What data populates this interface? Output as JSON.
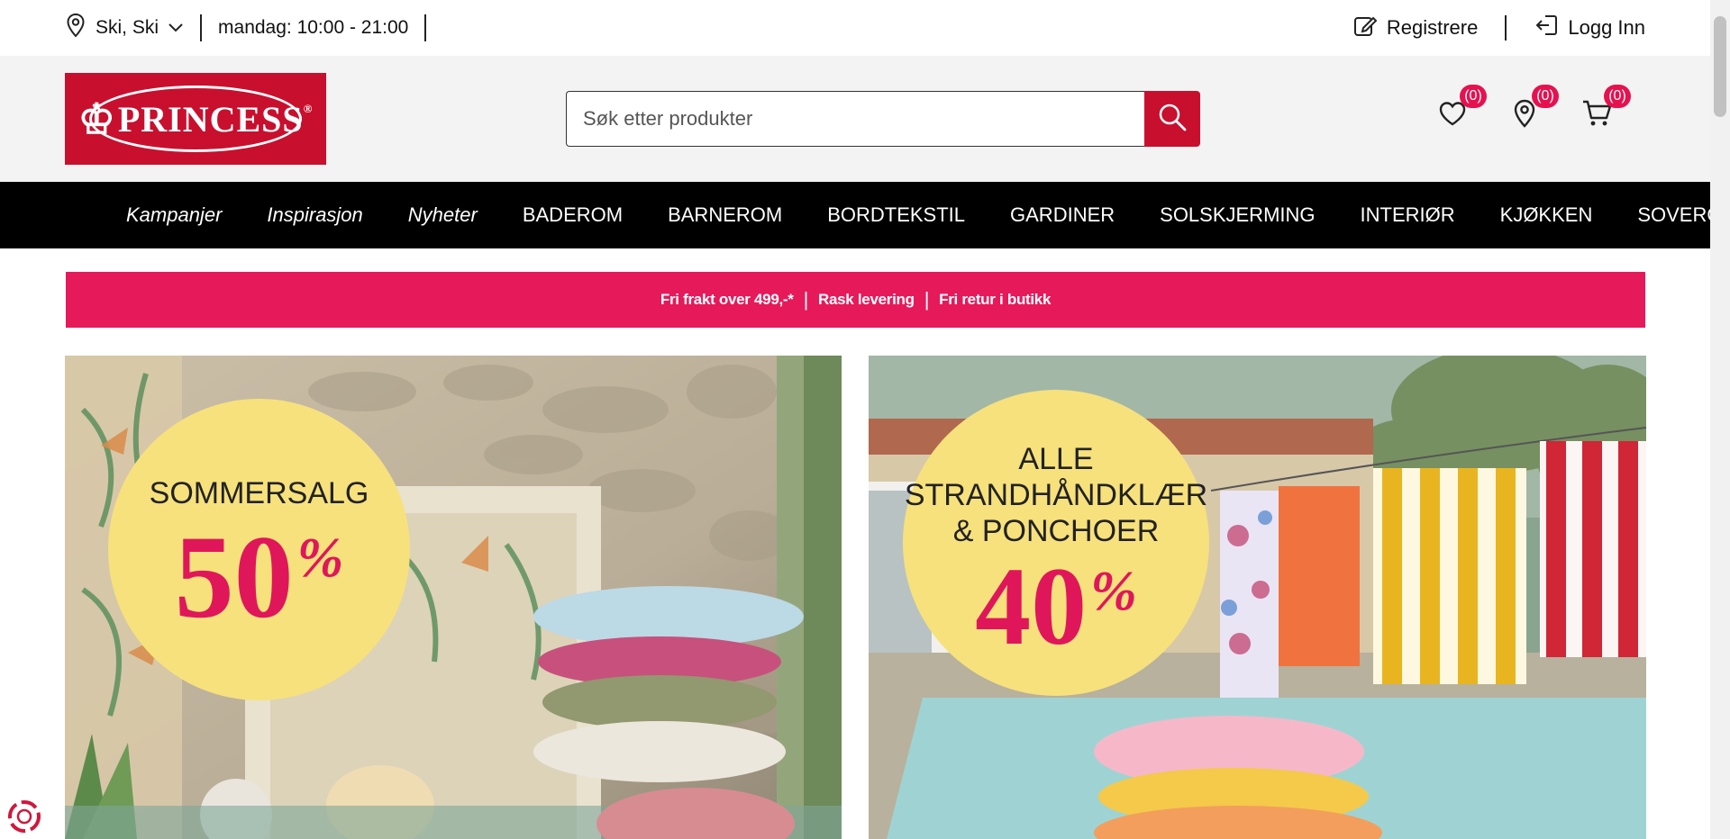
{
  "topbar": {
    "location": "Ski, Ski",
    "hours": "mandag: 10:00 - 21:00",
    "register": "Registrere",
    "login": "Logg Inn"
  },
  "header": {
    "logo_text": "PRINCESS",
    "search_placeholder": "Søk etter produkter",
    "wishlist_count": "(0)",
    "stores_count": "(0)",
    "cart_count": "(0)"
  },
  "nav": {
    "items": [
      {
        "label": "Kampanjer",
        "italic": true
      },
      {
        "label": "Inspirasjon",
        "italic": true
      },
      {
        "label": "Nyheter",
        "italic": true
      },
      {
        "label": "BADEROM"
      },
      {
        "label": "BARNEROM"
      },
      {
        "label": "BORDTEKSTIL"
      },
      {
        "label": "GARDINER"
      },
      {
        "label": "SOLSKJERMING"
      },
      {
        "label": "INTERIØR"
      },
      {
        "label": "KJØKKEN"
      },
      {
        "label": "SOVEROM"
      }
    ]
  },
  "promo": {
    "parts": [
      "Fri frakt over 499,-*",
      "Rask levering",
      "Fri retur i butikk"
    ]
  },
  "banners": {
    "left": {
      "title": "SOMMERSALG",
      "percent": "50",
      "percent_sign": "%"
    },
    "right": {
      "title_line1": "ALLE",
      "title_line2": "STRANDHÅNDKLÆR",
      "title_line3": "& PONCHOER",
      "percent": "40",
      "percent_sign": "%"
    }
  },
  "colors": {
    "brand_red": "#c8102e",
    "promo_pink": "#e6195a",
    "badge_pink": "#e6114f",
    "circle_yellow": "#f7e17c",
    "nav_black": "#000000"
  }
}
